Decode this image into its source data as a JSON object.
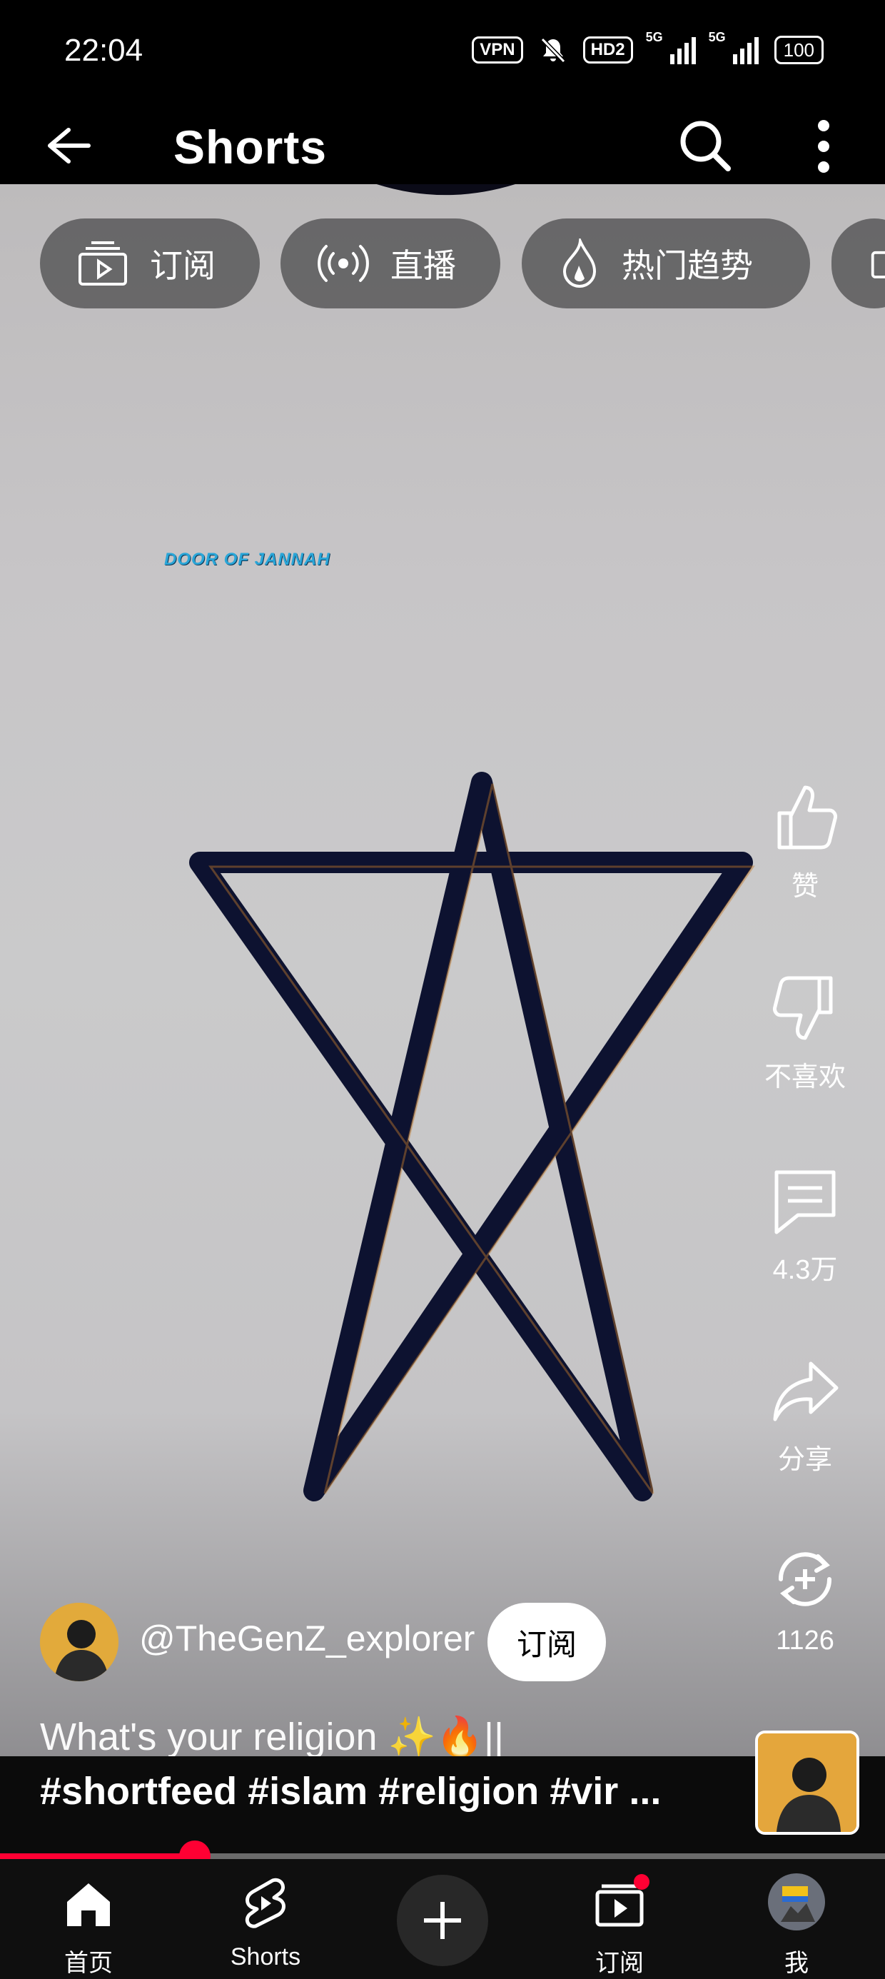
{
  "status_bar": {
    "time": "22:04",
    "vpn": "VPN",
    "hd": "HD2",
    "net1": "5G",
    "net2": "5G",
    "battery": "100"
  },
  "header": {
    "title": "Shorts"
  },
  "video": {
    "watermark": "DOOR OF JANNAH"
  },
  "chips": [
    {
      "label": "订阅",
      "icon": "subscriptions-icon"
    },
    {
      "label": "直播",
      "icon": "live-icon"
    },
    {
      "label": "热门趋势",
      "icon": "trending-icon"
    }
  ],
  "actions": {
    "like_label": "赞",
    "dislike_label": "不喜欢",
    "comments_count": "4.3万",
    "share_label": "分享",
    "remix_count": "1126"
  },
  "channel": {
    "handle": "@TheGenZ_explorer",
    "subscribe_label": "订阅"
  },
  "caption": {
    "text": "What's your religion ✨🔥||",
    "hashtags": "#shortfeed  #islam #religion #vir ..."
  },
  "progress": {
    "fraction": 0.22
  },
  "bottom_nav": {
    "home": "首页",
    "shorts": "Shorts",
    "subscriptions": "订阅",
    "you": "我"
  },
  "colors": {
    "accent": "#ff0033",
    "background": "#000000"
  }
}
